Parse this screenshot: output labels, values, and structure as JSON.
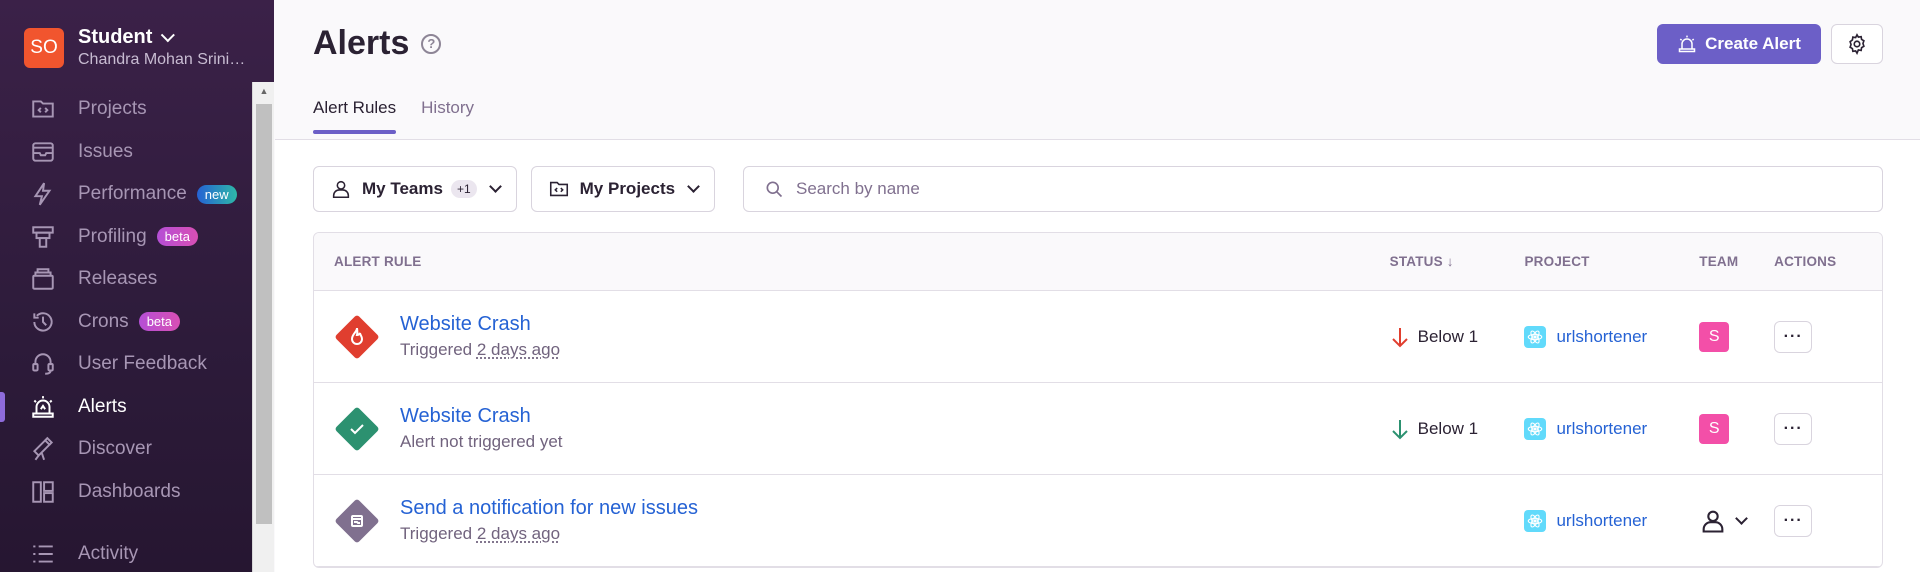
{
  "org": {
    "avatar": "SO",
    "name": "Student",
    "user": "Chandra Mohan Srinivasan"
  },
  "sidebar": {
    "items": [
      {
        "label": "Projects",
        "icon": "projects-icon"
      },
      {
        "label": "Issues",
        "icon": "issues-icon"
      },
      {
        "label": "Performance",
        "icon": "performance-icon",
        "badge": "new"
      },
      {
        "label": "Profiling",
        "icon": "profiling-icon",
        "badge": "beta"
      },
      {
        "label": "Releases",
        "icon": "releases-icon"
      },
      {
        "label": "Crons",
        "icon": "crons-icon",
        "badge": "beta"
      },
      {
        "label": "User Feedback",
        "icon": "user-feedback-icon"
      },
      {
        "label": "Alerts",
        "icon": "alerts-icon",
        "active": true
      },
      {
        "label": "Discover",
        "icon": "discover-icon"
      },
      {
        "label": "Dashboards",
        "icon": "dashboards-icon"
      },
      {
        "label": "Activity",
        "icon": "activity-icon"
      }
    ]
  },
  "header": {
    "title": "Alerts",
    "help": "?",
    "create_label": "Create Alert",
    "tabs": [
      {
        "label": "Alert Rules",
        "active": true
      },
      {
        "label": "History"
      }
    ]
  },
  "filters": {
    "teams_label": "My Teams",
    "teams_count": "+1",
    "projects_label": "My Projects",
    "search_placeholder": "Search by name"
  },
  "table": {
    "headers": {
      "rule": "ALERT RULE",
      "status": "STATUS",
      "project": "PROJECT",
      "team": "TEAM",
      "actions": "ACTIONS"
    },
    "rows": [
      {
        "name": "Website Crash",
        "sub_prefix": "Triggered",
        "sub_time": "2 days ago",
        "status": "Below 1",
        "status_color": "#e03e2f",
        "project": "urlshortener",
        "team": "S",
        "icon_color": "#e03e2f",
        "icon": "fire-icon"
      },
      {
        "name": "Website Crash",
        "sub_prefix": "Alert not triggered yet",
        "sub_time": "",
        "status": "Below 1",
        "status_color": "#2c9170",
        "project": "urlshortener",
        "team": "S",
        "icon_color": "#2c9170",
        "icon": "checkmark-icon"
      },
      {
        "name": "Send a notification for new issues",
        "sub_prefix": "Triggered",
        "sub_time": "2 days ago",
        "status": "",
        "project": "urlshortener",
        "team": "",
        "icon_color": "#80708f",
        "icon": "issue-icon"
      }
    ]
  },
  "colors": {
    "accent": "#6c5fc7",
    "link": "#2562d4",
    "sidebar_bg": "#2d1b3a"
  }
}
